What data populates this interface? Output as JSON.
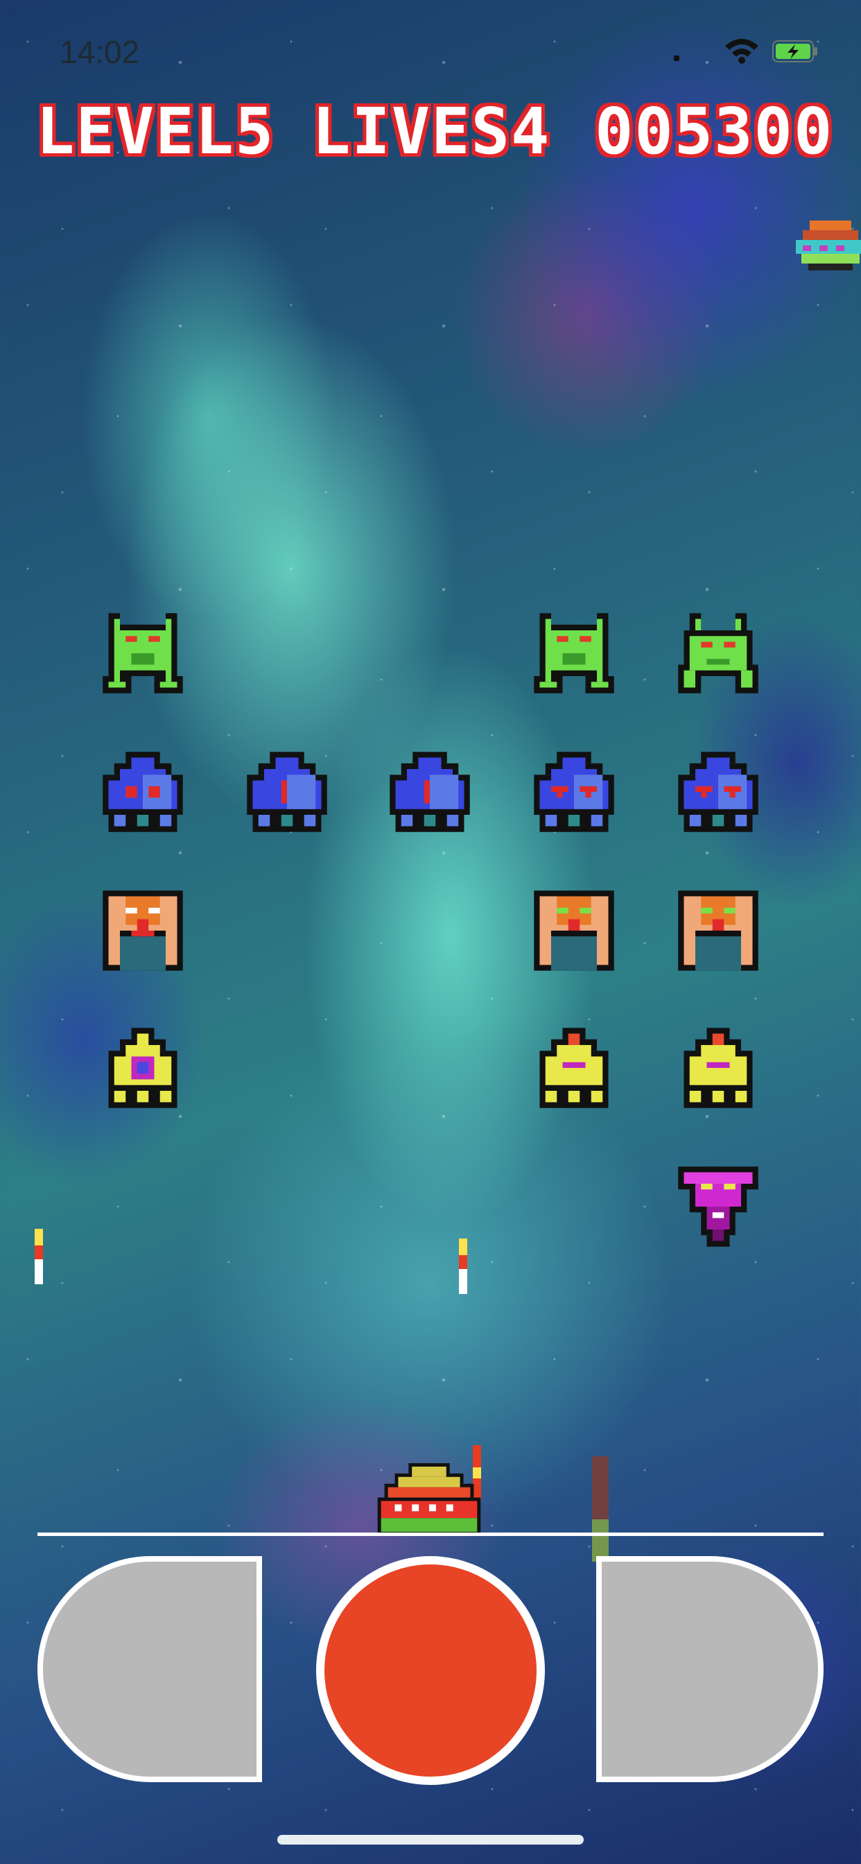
{
  "status_bar": {
    "time": "14:02",
    "wifi_icon": "wifi-icon",
    "battery_icon": "battery-charging-icon"
  },
  "hud": {
    "level": "LEVEL5",
    "lives": "LIVES4",
    "score": "005300"
  },
  "colors": {
    "hud_outline": "#e1252a",
    "fire_button": "#e84526",
    "control_pad": "#b8b8b8"
  },
  "aliens": [
    {
      "row": 1,
      "col": 1,
      "type": "green-crab"
    },
    {
      "row": 1,
      "col": 4,
      "type": "green-crab"
    },
    {
      "row": 1,
      "col": 5,
      "type": "green-crab"
    },
    {
      "row": 2,
      "col": 1,
      "type": "blue-squid"
    },
    {
      "row": 2,
      "col": 2,
      "type": "blue-squid"
    },
    {
      "row": 2,
      "col": 3,
      "type": "blue-squid"
    },
    {
      "row": 2,
      "col": 4,
      "type": "blue-squid"
    },
    {
      "row": 2,
      "col": 5,
      "type": "blue-squid"
    },
    {
      "row": 3,
      "col": 1,
      "type": "orange-beetle"
    },
    {
      "row": 3,
      "col": 4,
      "type": "orange-beetle"
    },
    {
      "row": 3,
      "col": 5,
      "type": "orange-beetle"
    },
    {
      "row": 4,
      "col": 1,
      "type": "yellow-drone"
    },
    {
      "row": 4,
      "col": 4,
      "type": "yellow-drone"
    },
    {
      "row": 4,
      "col": 5,
      "type": "yellow-drone"
    },
    {
      "row": 5,
      "col": 5,
      "type": "magenta-diver"
    }
  ],
  "controls": {
    "left": "move-left-button",
    "fire": "fire-button",
    "right": "move-right-button"
  }
}
